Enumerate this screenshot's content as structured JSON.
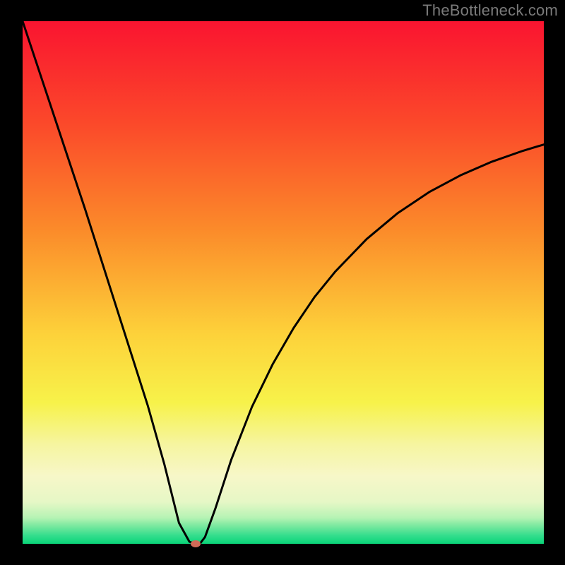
{
  "attribution": "TheBottleneck.com",
  "chart_data": {
    "type": "line",
    "title": "",
    "xlabel": "",
    "ylabel": "",
    "xlim": [
      0,
      100
    ],
    "ylim": [
      0,
      100
    ],
    "legend": false,
    "grid": false,
    "background_gradient": {
      "stops": [
        {
          "offset": 0.0,
          "color": "#fa1430"
        },
        {
          "offset": 0.2,
          "color": "#fb4a2a"
        },
        {
          "offset": 0.4,
          "color": "#fb8b2a"
        },
        {
          "offset": 0.6,
          "color": "#fdd23a"
        },
        {
          "offset": 0.73,
          "color": "#f7f24a"
        },
        {
          "offset": 0.81,
          "color": "#f6f5a0"
        },
        {
          "offset": 0.87,
          "color": "#f7f7c8"
        },
        {
          "offset": 0.92,
          "color": "#e6f7c6"
        },
        {
          "offset": 0.95,
          "color": "#b6f3b4"
        },
        {
          "offset": 0.965,
          "color": "#7de9a0"
        },
        {
          "offset": 0.985,
          "color": "#31dd8c"
        },
        {
          "offset": 1.0,
          "color": "#0ad478"
        }
      ]
    },
    "series": [
      {
        "name": "bottleneck-curve",
        "color": "#000000",
        "stroke_width": 3,
        "x": [
          0,
          4,
          8,
          12,
          16,
          20,
          24,
          27.2,
          30,
          32,
          33,
          34,
          35,
          37,
          40,
          44,
          48,
          52,
          56,
          60,
          66,
          72,
          78,
          84,
          90,
          96,
          100
        ],
        "values": [
          100,
          88,
          76,
          64,
          51.5,
          39,
          26.5,
          15.2,
          4,
          0.4,
          0,
          0,
          1.3,
          6.8,
          16,
          26.2,
          34.4,
          41.3,
          47.2,
          52.1,
          58.3,
          63.3,
          67.3,
          70.5,
          73.1,
          75.2,
          76.4
        ]
      }
    ],
    "marker": {
      "label": "minimum-point",
      "x": 33.2,
      "y_value": 0,
      "color": "#d06a57",
      "rx": 7,
      "ry": 5
    }
  }
}
